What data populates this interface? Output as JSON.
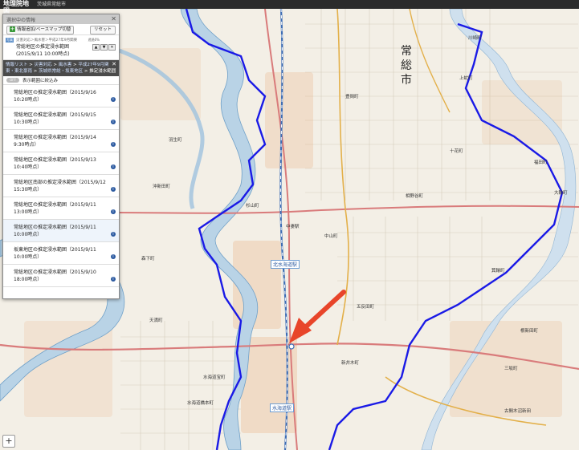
{
  "topbar": {
    "logo_title": "地理院地図",
    "logo_sub": "(電子国土Web)",
    "crumbs": "茨城県常総市"
  },
  "panel": {
    "header_title": "選択中の情報",
    "close_icon": "close-icon",
    "add_button_label": "情報追加/ベースマップ切替",
    "reset_button_label": "リセット",
    "layer": {
      "tag": "写真",
      "source": "災害対応＞風水害＞平成27年9月関東",
      "opacity_label": "透過0%",
      "name": "常総地区の推定浸水範囲",
      "time": "(2015/9/11 10:00時点)"
    },
    "breadcrumb": {
      "links": [
        "情報リスト",
        "災害対応",
        "風水害",
        "平成27年9月関東・東北豪雨",
        "茨城県常総・坂東地区"
      ],
      "last": "推定浸水範囲",
      "separator": ">"
    },
    "filter": {
      "toggle_label": "OFF",
      "label": "表示範囲に絞込み"
    },
    "items": [
      {
        "title": "常総地区の推定浸水範囲（2015/9/16 10:20時点）"
      },
      {
        "title": "常総地区の推定浸水範囲（2015/9/15 10:30時点）"
      },
      {
        "title": "常総地区の推定浸水範囲（2015/9/14 9:30時点）"
      },
      {
        "title": "常総地区の推定浸水範囲（2015/9/13 10:40時点）"
      },
      {
        "title": "常総地区南部の推定浸水範囲（2015/9/12 15:30時点）"
      },
      {
        "title": "常総地区の推定浸水範囲（2015/9/11 13:00時点）"
      },
      {
        "title": "常総地区の推定浸水範囲（2015/9/11 10:00時点）"
      },
      {
        "title": "坂東地区の推定浸水範囲（2015/9/11 10:00時点）"
      },
      {
        "title": "常総地区の推定浸水範囲（2015/9/10 18:00時点）"
      }
    ],
    "selected_index": 6
  },
  "map": {
    "city_label_1": "常",
    "city_label_2": "総",
    "city_label_3": "市",
    "place_labels": [
      "水海道駅",
      "北水海道駅",
      "中妻駅",
      "新井木町",
      "中山町",
      "大輪町",
      "箕輪町",
      "杉山町",
      "五反田町",
      "十花町",
      "相野谷町",
      "豊岡町",
      "川崎町",
      "福田町",
      "上蛇町",
      "古間木沼新田",
      "三坂町",
      "根新田町",
      "水海道宝町",
      "水海道橋本町",
      "森下町",
      "天満町",
      "羽生町",
      "沖新田町"
    ],
    "colors": {
      "flood_boundary": "#1a1ae6",
      "arrow": "#e8452a",
      "river": "#b9d3e6",
      "river_edge": "#6fa0c8",
      "main_road": "#d97b7b",
      "rail": "#3d6db5"
    }
  },
  "controls": {
    "zoom_in_label": "+"
  }
}
